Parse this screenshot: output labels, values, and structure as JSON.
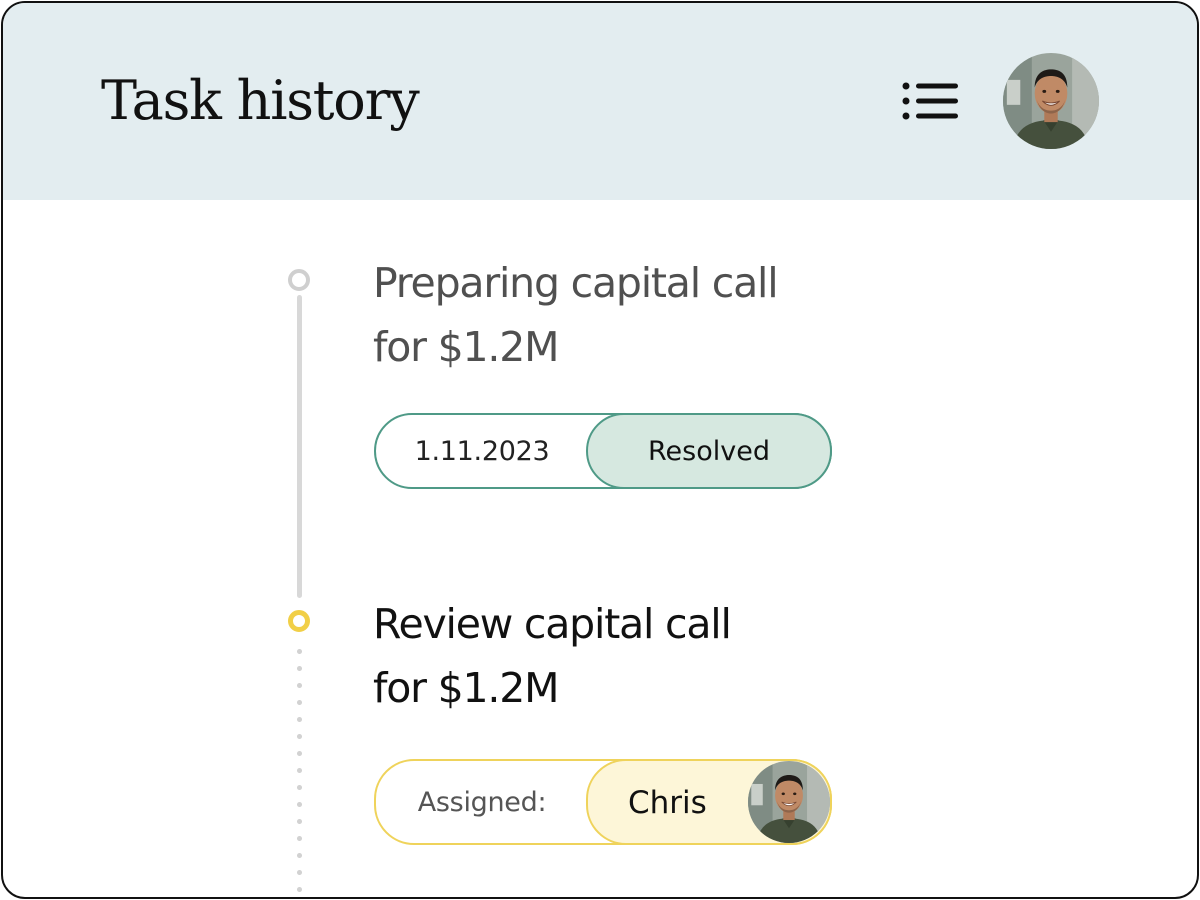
{
  "header": {
    "title": "Task history",
    "menu_icon": "list-icon",
    "avatar_icon": "user-avatar"
  },
  "tasks": [
    {
      "title_line1": "Preparing capital call",
      "title_line2": "for $1.2M",
      "date": "1.11.2023",
      "status": "Resolved",
      "state": "done"
    },
    {
      "title_line1": "Review capital call",
      "title_line2": "for $1.2M",
      "assigned_label": "Assigned:",
      "assignee": "Chris",
      "state": "active"
    }
  ],
  "colors": {
    "header_bg": "#e3edf0",
    "resolved_accent": "#4f9a87",
    "resolved_fill": "#d6e8e0",
    "active_accent": "#f1cf47",
    "active_fill": "#fdf6d8"
  }
}
